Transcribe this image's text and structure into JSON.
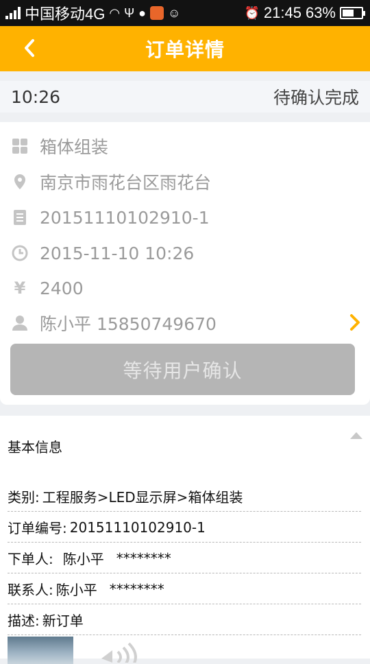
{
  "status_bar": {
    "carrier": "中国移动4G",
    "time": "21:45",
    "battery": "63%",
    "battery_level": 0.63,
    "icons": [
      "signal-icon",
      "wifi-icon",
      "usb-icon",
      "cat-icon",
      "app-notification-icon",
      "chat-icon",
      "alarm-icon",
      "battery-icon"
    ]
  },
  "header": {
    "title": "订单详情",
    "accent_color": "#ffb200"
  },
  "order_strip": {
    "time": "10:26",
    "status": "待确认完成"
  },
  "summary": {
    "category": "箱体组装",
    "address": "南京市雨花台区雨花台",
    "order_no": "20151110102910-1",
    "datetime": "2015-11-10 10:26",
    "price_symbol": "¥",
    "price": "2400",
    "contact": "陈小平 15850749670",
    "button_label": "等待用户确认"
  },
  "basic_info": {
    "title": "基本信息",
    "rows": [
      {
        "label": "类别:",
        "value": "工程服务>LED显示屏>箱体组装"
      },
      {
        "label": "订单编号:",
        "value": "20151110102910-1"
      },
      {
        "label": "下单人:",
        "value": "陈小平",
        "extra": "********"
      },
      {
        "label": "联系人:",
        "value": "陈小平",
        "extra": "********"
      },
      {
        "label": "描述:",
        "value": "新订单"
      }
    ]
  }
}
